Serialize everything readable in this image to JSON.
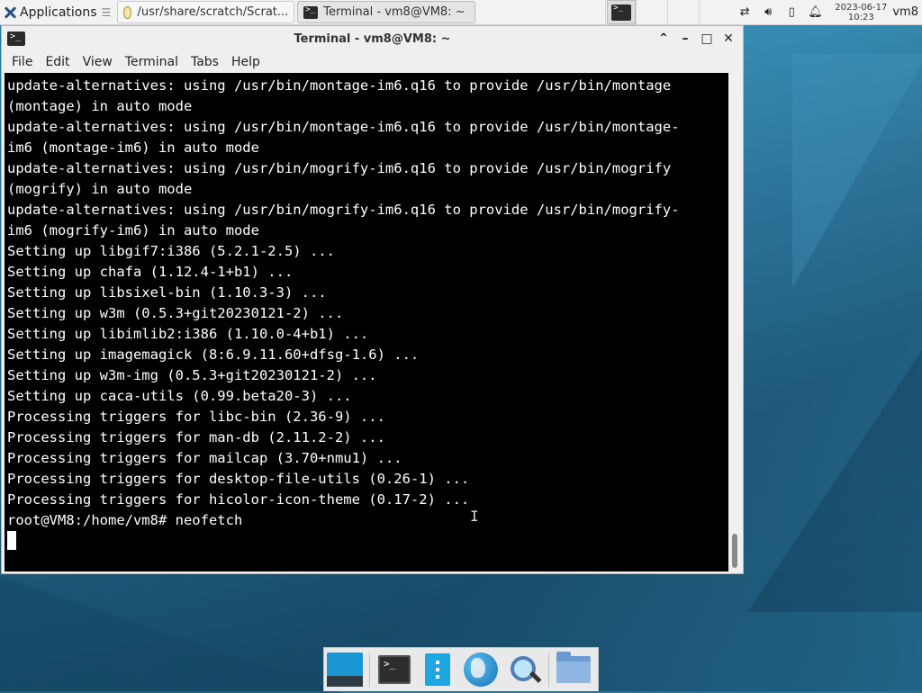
{
  "panel": {
    "apps_label": "Applications",
    "tasks": [
      {
        "label": "/usr/share/scratch/Scrat...",
        "icon": "file-manager-icon"
      },
      {
        "label": "Terminal - vm8@VM8: ~",
        "icon": "terminal-icon"
      }
    ],
    "clock_date": "2023-06-17",
    "clock_time": "10:23",
    "user": "vm8"
  },
  "window": {
    "title": "Terminal - vm8@VM8: ~",
    "menu": [
      "File",
      "Edit",
      "View",
      "Terminal",
      "Tabs",
      "Help"
    ]
  },
  "terminal": {
    "lines": [
      "update-alternatives: using /usr/bin/montage-im6.q16 to provide /usr/bin/montage",
      "(montage) in auto mode",
      "update-alternatives: using /usr/bin/montage-im6.q16 to provide /usr/bin/montage-",
      "im6 (montage-im6) in auto mode",
      "update-alternatives: using /usr/bin/mogrify-im6.q16 to provide /usr/bin/mogrify",
      "(mogrify) in auto mode",
      "update-alternatives: using /usr/bin/mogrify-im6.q16 to provide /usr/bin/mogrify-",
      "im6 (mogrify-im6) in auto mode",
      "Setting up libgif7:i386 (5.2.1-2.5) ...",
      "Setting up chafa (1.12.4-1+b1) ...",
      "Setting up libsixel-bin (1.10.3-3) ...",
      "Setting up w3m (0.5.3+git20230121-2) ...",
      "Setting up libimlib2:i386 (1.10.0-4+b1) ...",
      "Setting up imagemagick (8:6.9.11.60+dfsg-1.6) ...",
      "Setting up w3m-img (0.5.3+git20230121-2) ...",
      "Setting up caca-utils (0.99.beta20-3) ...",
      "Processing triggers for libc-bin (2.36-9) ...",
      "Processing triggers for man-db (2.11.2-2) ...",
      "Processing triggers for mailcap (3.70+nmu1) ...",
      "Processing triggers for desktop-file-utils (0.26-1) ...",
      "Processing triggers for hicolor-icon-theme (0.17-2) ...",
      "root@VM8:/home/vm8# neofetch"
    ]
  },
  "dock": {
    "items": [
      "show-desktop-icon",
      "terminal-icon",
      "file-manager-icon",
      "web-browser-icon",
      "app-finder-icon",
      "folder-icon"
    ]
  }
}
